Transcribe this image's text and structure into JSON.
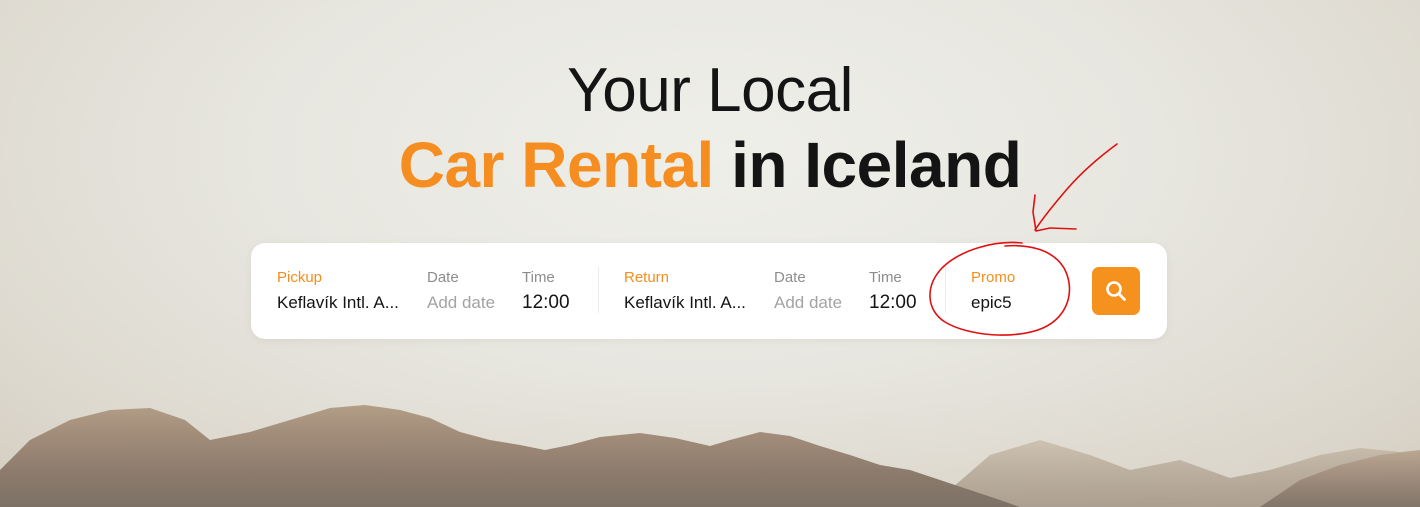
{
  "headline": {
    "line1": "Your Local",
    "line2_accent": "Car Rental",
    "line2_rest": " in Iceland"
  },
  "search": {
    "pickup": {
      "label": "Pickup",
      "value": "Keflavík Intl. A..."
    },
    "pickup_date": {
      "label": "Date",
      "placeholder": "Add date"
    },
    "pickup_time": {
      "label": "Time",
      "value": "12:00"
    },
    "return": {
      "label": "Return",
      "value": "Keflavík Intl. A..."
    },
    "return_date": {
      "label": "Date",
      "placeholder": "Add date"
    },
    "return_time": {
      "label": "Time",
      "value": "12:00"
    },
    "promo": {
      "label": "Promo",
      "value": "epic5"
    },
    "button_icon": "search-icon"
  },
  "colors": {
    "accent": "#f58d20",
    "text": "#141414",
    "annotation": "#e01010"
  }
}
